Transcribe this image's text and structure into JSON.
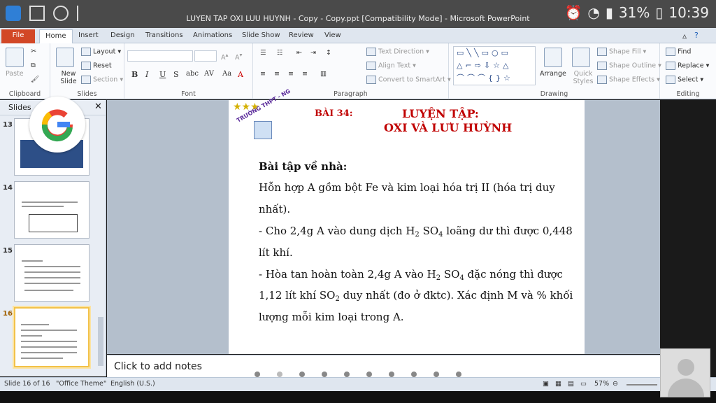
{
  "window": {
    "title": "LUYEN TAP OXI  LUU HUYNH - Copy - Copy.ppt [Compatibility Mode] - Microsoft PowerPoint",
    "status_time": "10:39",
    "battery": "31%"
  },
  "ribbon": {
    "tabs": [
      "File",
      "Home",
      "Insert",
      "Design",
      "Transitions",
      "Animations",
      "Slide Show",
      "Review",
      "View"
    ],
    "clipboard": {
      "paste": "Paste",
      "label": "Clipboard"
    },
    "slides": {
      "new_slide": "New Slide",
      "layout": "Layout",
      "reset": "Reset",
      "section": "Section",
      "label": "Slides"
    },
    "font": {
      "label": "Font",
      "bold": "B",
      "italic": "I",
      "underline": "U",
      "strike": "S",
      "shadow": "abc",
      "spacing": "AV",
      "case": "Aa"
    },
    "paragraph": {
      "text_direction": "Text Direction",
      "align_text": "Align Text",
      "smartart": "Convert to SmartArt",
      "label": "Paragraph"
    },
    "drawing": {
      "arrange": "Arrange",
      "quick_styles": "Quick Styles",
      "shape_fill": "Shape Fill",
      "shape_outline": "Shape Outline",
      "shape_effects": "Shape Effects",
      "label": "Drawing"
    },
    "editing": {
      "find": "Find",
      "replace": "Replace",
      "select": "Select",
      "label": "Editing"
    }
  },
  "slide_panel": {
    "tabs_label": "Slides",
    "thumbnails": [
      {
        "num": "13"
      },
      {
        "num": "14"
      },
      {
        "num": "15"
      },
      {
        "num": "16",
        "selected": true
      }
    ]
  },
  "slide": {
    "school": "TRƯỜNG THPT - NG",
    "lesson": "BÀI 34:",
    "title_line1": "LUYỆN TẬP:",
    "title_line2": "OXI VÀ LƯU HUỲNH",
    "heading": "Bài tập về nhà:",
    "lines": {
      "l1": "Hỗn hợp A gồm bột Fe và kim loại hóa trị II (hóa trị duy",
      "l2": "nhất).",
      "l3a": "- Cho 2,4g A vào dung dịch H",
      "l3sub1": "2",
      "l3b": " SO",
      "l3sub2": "4",
      "l3c": "  loãng dư thì được 0,448",
      "l4": "lít khí.",
      "l5a": "- Hòa tan hoàn toàn 2,4g A vào H",
      "l5sub1": "2",
      "l5b": " SO",
      "l5sub2": "4",
      "l5c": "  đặc nóng thì được",
      "l6a": "1,12 lít khí SO",
      "l6sub": "2",
      "l6b": "  duy nhất (đo ở đktc). Xác định M và % khối",
      "l7": "lượng mỗi kim loại trong A."
    }
  },
  "notes": {
    "placeholder": "Click to add notes"
  },
  "statusbar": {
    "slide": "Slide 16 of 16",
    "theme": "\"Office Theme\"",
    "language": "English (U.S.)",
    "zoom": "57%"
  },
  "colors": {
    "title_red": "#c00000",
    "file_tab": "#d24726",
    "selection": "#f2c24a"
  }
}
